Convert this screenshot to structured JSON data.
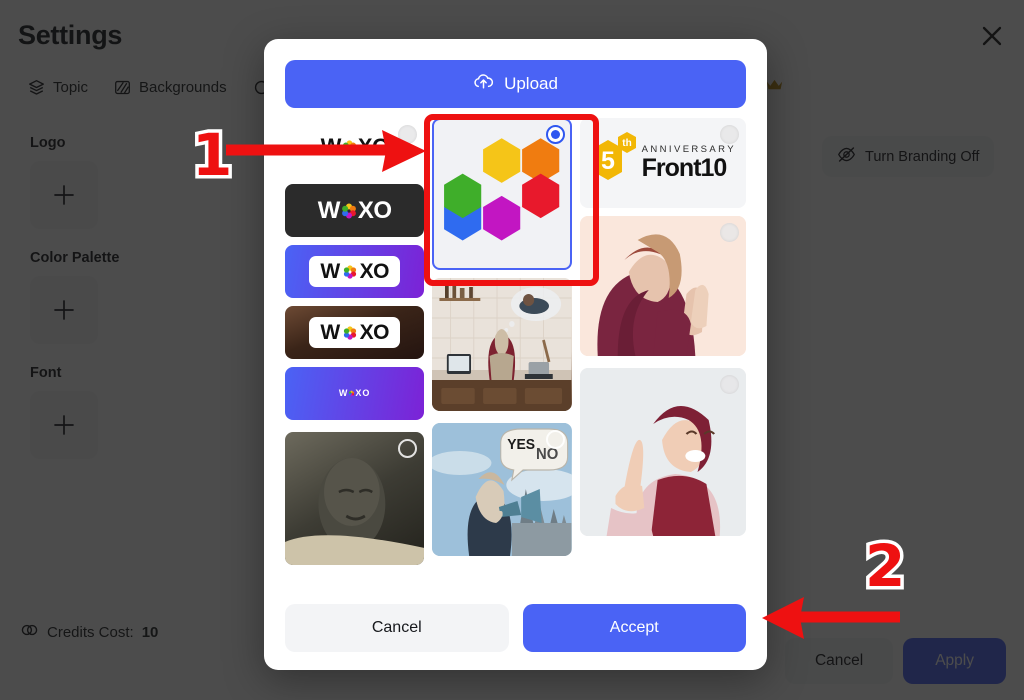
{
  "page": {
    "title": "Settings",
    "close_icon": "close-x-icon",
    "tabs": [
      {
        "label": "Topic",
        "icon": "layers-icon"
      },
      {
        "label": "Backgrounds",
        "icon": "stripes-icon"
      },
      {
        "label": "",
        "icon": "partially-hidden-tab-icon"
      }
    ],
    "crown_icon": "crown-icon",
    "sections": [
      {
        "label": "Logo",
        "add_icon": "plus-icon"
      },
      {
        "label": "Color Palette",
        "add_icon": "plus-icon"
      },
      {
        "label": "Font",
        "add_icon": "plus-icon"
      }
    ],
    "branding_button": {
      "label": "Turn Branding Off",
      "icon": "eye-off-icon"
    },
    "credits": {
      "icon": "credits-coins-icon",
      "label": "Credits Cost:",
      "value": "10"
    },
    "footer": {
      "cancel_label": "Cancel",
      "apply_label": "Apply"
    }
  },
  "modal": {
    "upload_label": "Upload",
    "upload_icon": "cloud-upload-icon",
    "cancel_label": "Cancel",
    "accept_label": "Accept",
    "items": [
      {
        "id": "woxo-white",
        "name": "WOXO logo white",
        "brand": "WOXO",
        "selected": false,
        "radio": "radio-unchecked"
      },
      {
        "id": "hexagon-flower",
        "name": "Hexagon flower logo",
        "brand": "",
        "selected": true,
        "radio": "radio-checked"
      },
      {
        "id": "front10-anniv",
        "name": "Front10 5th Anniversary",
        "brand": "Front10",
        "number": "5",
        "ordinal": "th",
        "subtitle": "ANNIVERSARY",
        "selected": false,
        "radio": "radio-unchecked"
      },
      {
        "id": "woxo-dark",
        "name": "WOXO logo dark",
        "brand": "WOXO",
        "selected": false,
        "radio": "radio-unchecked"
      },
      {
        "id": "woxo-gradient",
        "name": "WOXO logo gradient",
        "brand": "WOXO",
        "selected": false,
        "radio": "radio-unchecked"
      },
      {
        "id": "woxo-fire",
        "name": "WOXO logo fire background",
        "brand": "WOXO",
        "selected": false,
        "radio": "radio-unchecked"
      },
      {
        "id": "woxo-purple",
        "name": "WOXO small purple",
        "brand": "WOXO",
        "selected": false,
        "radio": "radio-unchecked"
      },
      {
        "id": "photo-kitchen",
        "name": "Woman cooking in kitchen",
        "selected": false,
        "radio": "radio-unchecked"
      },
      {
        "id": "photo-praying",
        "name": "Woman praying in hijab",
        "selected": false,
        "radio": "radio-unchecked"
      },
      {
        "id": "photo-mummy",
        "name": "Ancient mummy face",
        "selected": false,
        "radio": "radio-unchecked"
      },
      {
        "id": "photo-yesno",
        "name": "Woman with megaphone",
        "bubble_yes": "YES",
        "bubble_no": "NO",
        "selected": false,
        "radio": "radio-unchecked"
      },
      {
        "id": "photo-pointing",
        "name": "Woman pointing up",
        "selected": false,
        "radio": "radio-unchecked"
      }
    ]
  },
  "annotations": [
    {
      "id": "step-1",
      "label": "1",
      "target": "hexagon-flower-card",
      "arrow": "arrow-right"
    },
    {
      "id": "step-2",
      "label": "2",
      "target": "accept-button",
      "arrow": "arrow-left"
    }
  ],
  "colors": {
    "accent": "#4a63f5",
    "overlay": "#141414",
    "annotation": "#ee1111",
    "crown": "#b8860b"
  }
}
